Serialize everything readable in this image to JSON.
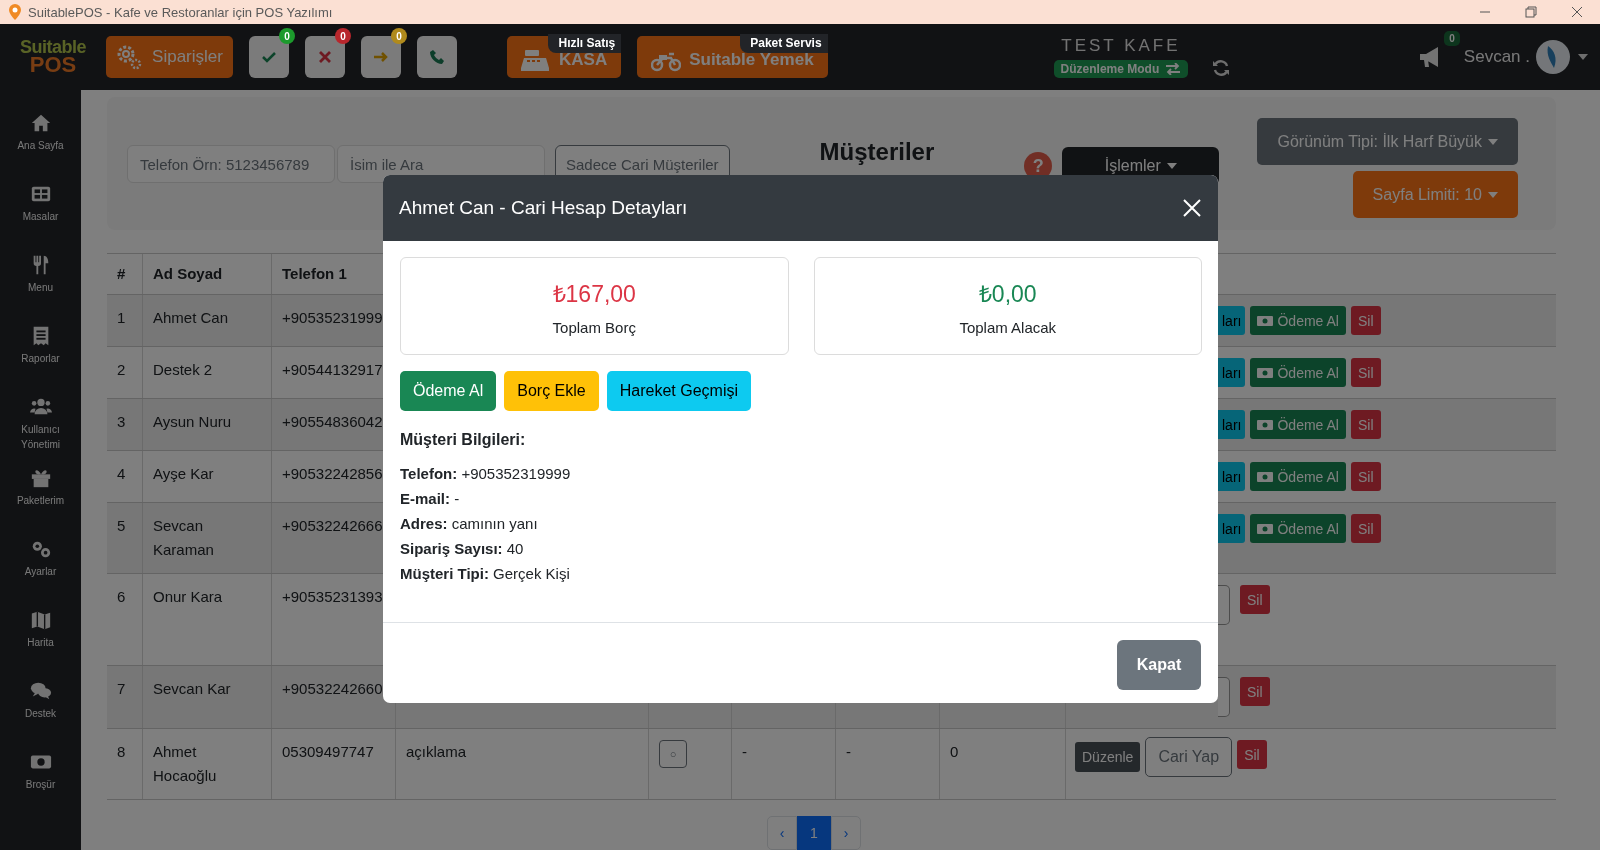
{
  "window": {
    "title": "SuitablePOS - Kafe ve Restoranlar için POS Yazılımı"
  },
  "topbar": {
    "logo": {
      "line_1": "Suitable",
      "line_2": "POS"
    },
    "orders_button": "Siparişler",
    "status_buttons": [
      {
        "kind": "approved",
        "badge": "0",
        "color": "#1c9a2c"
      },
      {
        "kind": "rejected",
        "badge": "0",
        "color": "#b8262c"
      },
      {
        "kind": "forwarded",
        "badge": "0",
        "color": "#b08a1c"
      },
      {
        "kind": "call"
      }
    ],
    "quick_buttons": [
      {
        "kind": "register",
        "label": "KASA",
        "tag": "Hızlı Satış"
      },
      {
        "kind": "delivery",
        "label": "Suitable Yemek",
        "tag": "Paket Servis"
      }
    ],
    "venue": "TEST KAFE",
    "mode_badge": "Düzenleme Modu",
    "notifications_badge": "0",
    "user": "Sevcan ."
  },
  "sidebar": {
    "items": [
      {
        "kind": "home",
        "label": "Ana Sayfa"
      },
      {
        "kind": "tables",
        "label": "Masalar"
      },
      {
        "kind": "menu",
        "label": "Menu"
      },
      {
        "kind": "reports",
        "label": "Raporlar"
      },
      {
        "kind": "users",
        "label": "Kullanıcı Yönetimi"
      },
      {
        "kind": "packages",
        "label": "Paketlerim"
      },
      {
        "kind": "settings",
        "label": "Ayarlar"
      },
      {
        "kind": "map",
        "label": "Harita"
      },
      {
        "kind": "support",
        "label": "Destek"
      },
      {
        "kind": "brochure",
        "label": "Broşür"
      }
    ]
  },
  "page": {
    "filters": {
      "phone_placeholder": "Telefon Örn: 5123456789",
      "name_placeholder": "İsim ile Ara",
      "current_only_button": "Sadece Cari Müşteriler"
    },
    "title": "Müşteriler",
    "help": "?",
    "actions_button": "İşlemler",
    "view_type_button": "Görünüm Tipi: İlk Harf Büyük",
    "page_limit_button": "Sayfa Limiti: 10"
  },
  "table": {
    "columns": [
      "#",
      "Ad Soyad",
      "Telefon 1"
    ],
    "rows": [
      {
        "no": "1",
        "name": "Ahmet Can",
        "phone": "+90535231999",
        "actions": [
          {
            "kind": "partial",
            "label": "ları"
          },
          {
            "kind": "pay",
            "label": "Ödeme Al"
          },
          {
            "kind": "delete",
            "label": "Sil"
          }
        ]
      },
      {
        "no": "2",
        "name": "Destek 2",
        "phone": "+90544132917",
        "actions": [
          {
            "kind": "partial",
            "label": "ları"
          },
          {
            "kind": "pay",
            "label": "Ödeme Al"
          },
          {
            "kind": "delete",
            "label": "Sil"
          }
        ]
      },
      {
        "no": "3",
        "name": "Aysun Nuru",
        "phone": "+90554836042",
        "actions": [
          {
            "kind": "partial",
            "label": "ları"
          },
          {
            "kind": "pay",
            "label": "Ödeme Al"
          },
          {
            "kind": "delete",
            "label": "Sil"
          }
        ]
      },
      {
        "no": "4",
        "name": "Ayşe Kar",
        "phone": "+90532242856",
        "actions": [
          {
            "kind": "partial",
            "label": "ları"
          },
          {
            "kind": "pay",
            "label": "Ödeme Al"
          },
          {
            "kind": "delete",
            "label": "Sil"
          }
        ]
      },
      {
        "no": "5",
        "name": "Sevcan Karaman",
        "phone": "+90532242666",
        "actions": [
          {
            "kind": "partial",
            "label": "ları"
          },
          {
            "kind": "pay",
            "label": "Ödeme Al"
          },
          {
            "kind": "delete",
            "label": "Sil"
          }
        ]
      },
      {
        "no": "6",
        "name": "Onur Kara",
        "phone": "+90535231393",
        "actions": [
          {
            "kind": "stub"
          },
          {
            "kind": "delete",
            "label": "Sil"
          }
        ]
      },
      {
        "no": "7",
        "name": "Sevcan Kar",
        "phone": "+90532242660",
        "actions": [
          {
            "kind": "stub"
          },
          {
            "kind": "delete",
            "label": "Sil"
          }
        ]
      },
      {
        "no": "8",
        "name": "Ahmet Hocaoğlu",
        "phone": "05309497747",
        "extra_cells": [
          "açıklama",
          "○",
          "-",
          "-",
          "0"
        ],
        "actions": [
          {
            "kind": "edit",
            "label": "Düzenle"
          },
          {
            "kind": "make_current",
            "label": "Cari Yap"
          },
          {
            "kind": "delete",
            "label": "Sil"
          }
        ]
      }
    ]
  },
  "pagination": {
    "prev": "‹",
    "pages": [
      {
        "label": "1",
        "selected": true
      }
    ],
    "next": "›"
  },
  "modal": {
    "title": "Ahmet Can - Cari Hesap Detayları",
    "summary": [
      {
        "kind": "debt",
        "amount": "₺167,00",
        "label": "Toplam Borç"
      },
      {
        "kind": "credit",
        "amount": "₺0,00",
        "label": "Toplam Alacak"
      }
    ],
    "actions": [
      {
        "kind": "success",
        "label": "Ödeme Al"
      },
      {
        "kind": "warning",
        "label": "Borç Ekle"
      },
      {
        "kind": "info",
        "label": "Hareket Geçmişi"
      }
    ],
    "info_title": "Müşteri Bilgileri:",
    "info": [
      "**Telefon:** +905352319999",
      "**E-mail:** -",
      "**Adres:** camının yanı",
      "**Sipariş Sayısı:** 40",
      "**Müşteri Tipi:** Gerçek Kişi"
    ],
    "close_button": "Kapat"
  }
}
